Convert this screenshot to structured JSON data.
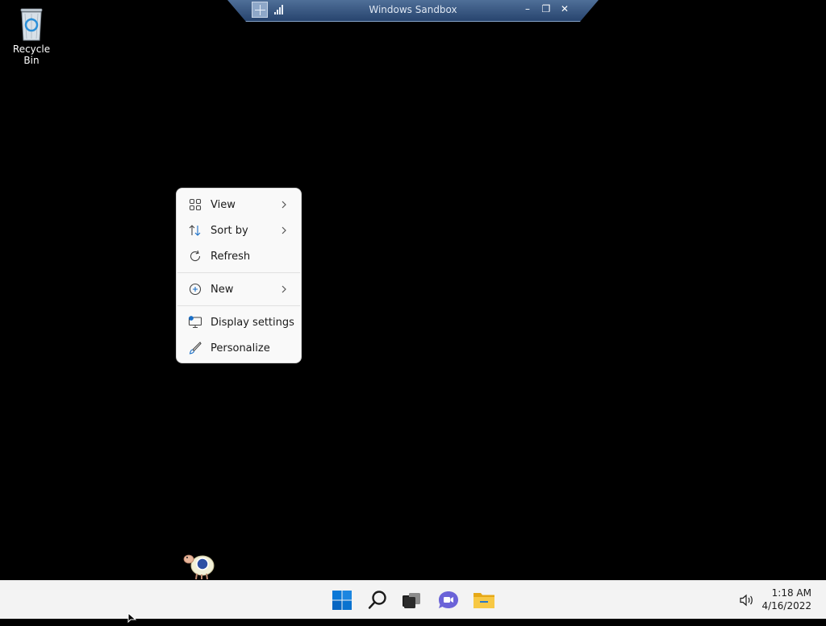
{
  "connection_bar": {
    "title": "Windows Sandbox",
    "minimize_glyph": "–",
    "restore_glyph": "❐",
    "close_glyph": "✕"
  },
  "desktop": {
    "icons": [
      {
        "label": "Recycle Bin",
        "icon": "recycle-bin-icon"
      }
    ]
  },
  "context_menu": {
    "items": [
      {
        "label": "View",
        "icon": "view-grid-icon",
        "submenu": true
      },
      {
        "label": "Sort by",
        "icon": "sort-icon",
        "submenu": true
      },
      {
        "label": "Refresh",
        "icon": "refresh-icon",
        "submenu": false
      },
      {
        "label": "New",
        "icon": "new-plus-icon",
        "submenu": true
      },
      {
        "label": "Display settings",
        "icon": "display-settings-icon",
        "submenu": false
      },
      {
        "label": "Personalize",
        "icon": "personalize-brush-icon",
        "submenu": false
      }
    ]
  },
  "taskbar": {
    "apps": [
      {
        "name": "start",
        "icon": "windows-start-icon"
      },
      {
        "name": "search",
        "icon": "search-icon"
      },
      {
        "name": "task-view",
        "icon": "task-view-icon"
      },
      {
        "name": "chat",
        "icon": "chat-icon"
      },
      {
        "name": "file-explorer",
        "icon": "file-explorer-icon"
      }
    ],
    "tray": {
      "volume_icon": "speaker-icon",
      "time": "1:18 AM",
      "date": "4/16/2022"
    }
  },
  "colors": {
    "desktop_bg": "#000000",
    "menu_bg": "#f9f9f9",
    "taskbar_bg": "#f3f3f3",
    "accent_blue": "#0a6fd6",
    "connection_bar": "#3a5a86"
  }
}
